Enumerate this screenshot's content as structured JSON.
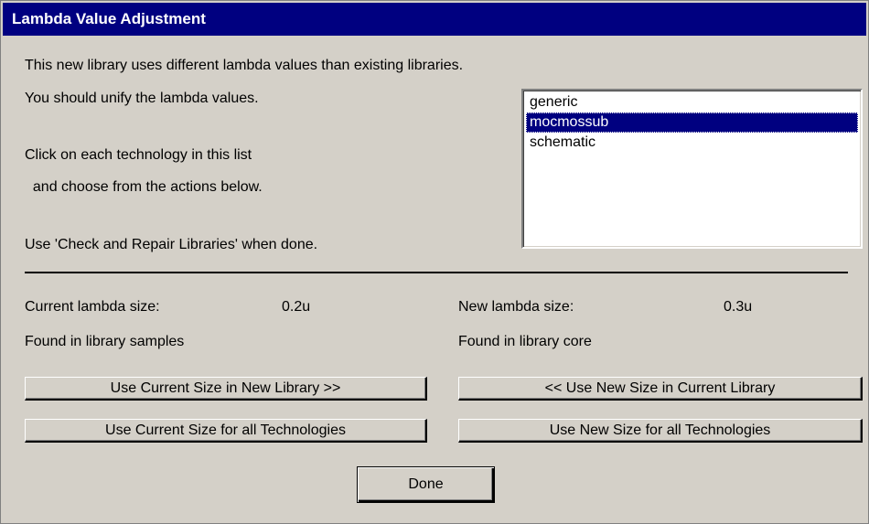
{
  "window": {
    "title": "Lambda Value Adjustment"
  },
  "messages": {
    "line1": "This new library uses different lambda values than existing libraries.",
    "line2": "You should unify the lambda values.",
    "line3": "Click on each technology in this list",
    "line4": "  and choose from the actions below.",
    "line5": "Use 'Check and Repair Libraries' when done."
  },
  "technology_list": {
    "items": [
      "generic",
      "mocmossub",
      "schematic"
    ],
    "selected": "mocmossub"
  },
  "current": {
    "label": "Current lambda size:",
    "value": "0.2u",
    "found": "Found in library samples"
  },
  "new": {
    "label": "New lambda size:",
    "value": "0.3u",
    "found": "Found in library core"
  },
  "buttons": {
    "use_current_in_new": "Use Current Size in New Library >>",
    "use_new_in_current": "<< Use New Size in Current Library",
    "use_current_all": "Use Current Size for all Technologies",
    "use_new_all": "Use New Size for all Technologies",
    "done": "Done"
  },
  "colors": {
    "titlebar": "#000080",
    "dialog_bg": "#d4d0c8",
    "selection": "#000080"
  }
}
